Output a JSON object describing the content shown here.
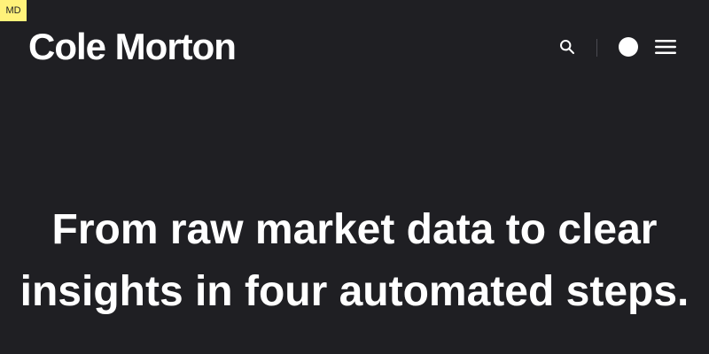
{
  "badge": {
    "label": "MD"
  },
  "header": {
    "logo_text": "Cole Morton",
    "actions": [
      {
        "name": "search",
        "icon": "search-icon"
      },
      {
        "name": "theme",
        "icon": "half-moon-icon"
      },
      {
        "name": "menu",
        "icon": "hamburger-icon"
      }
    ]
  },
  "hero": {
    "text": "From raw market data to clear insights in four automated steps."
  },
  "colors": {
    "background": "#1f1f23",
    "text": "#ffffff",
    "badge": "#fff27a",
    "divider": "#4a4a52"
  }
}
